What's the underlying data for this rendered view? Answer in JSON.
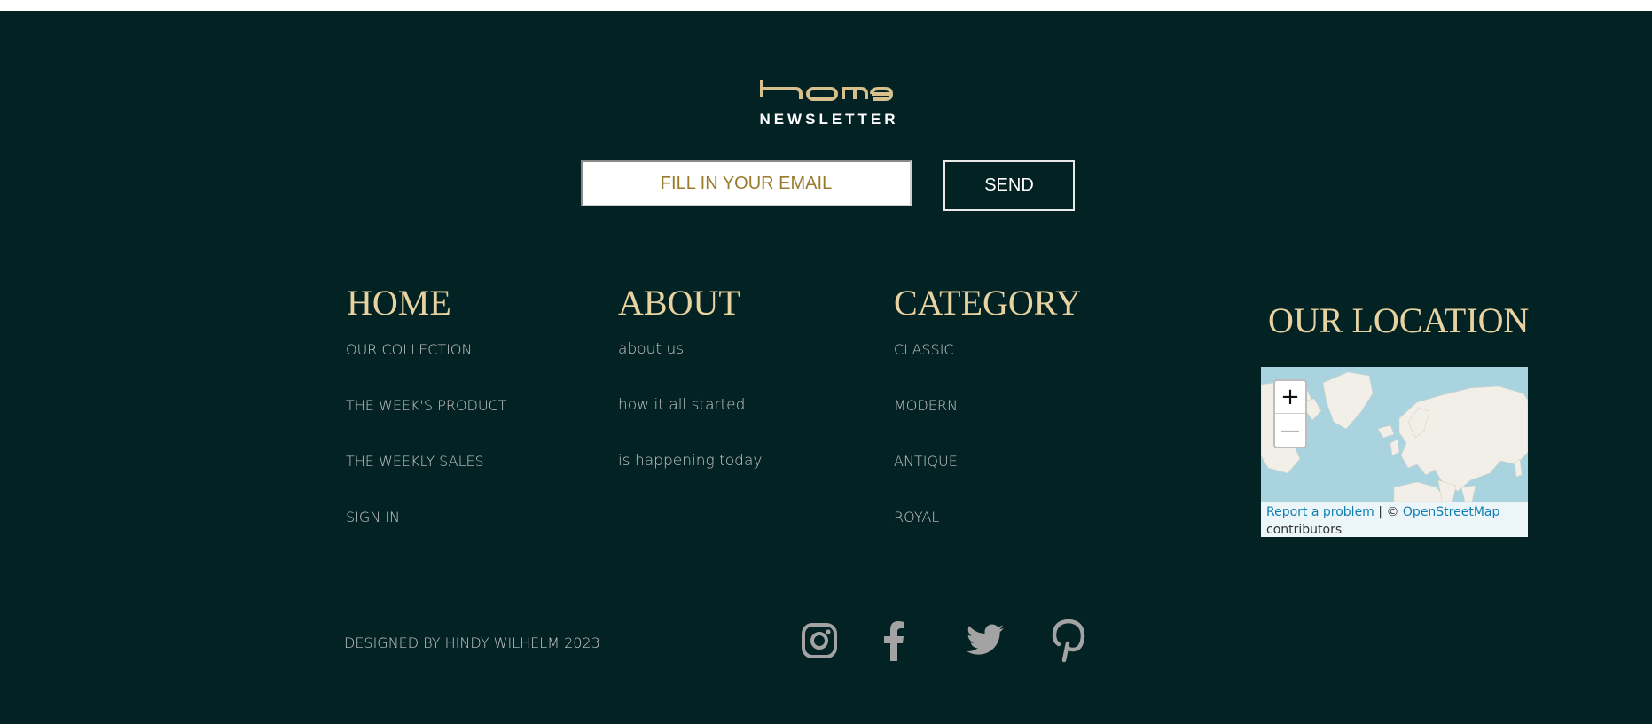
{
  "brand": {
    "logo_text": "home",
    "newsletter_title": "NEWSLETTER"
  },
  "newsletter": {
    "email_placeholder": "FILL IN YOUR EMAIL",
    "send_label": "SEND"
  },
  "columns": {
    "home": {
      "heading": "HOME",
      "links": [
        "OUR COLLECTION",
        "THE WEEK'S PRODUCT",
        "THE WEEKLY SALES",
        "SIGN IN"
      ]
    },
    "about": {
      "heading": "ABOUT",
      "links": [
        "about us",
        "how it all started",
        "is happening today"
      ]
    },
    "category": {
      "heading": "CATEGORY",
      "links": [
        "CLASSIC",
        "MODERN",
        "ANTIQUE",
        "ROYAL"
      ]
    }
  },
  "location": {
    "heading": "OUR LOCATION",
    "zoom_in": "+",
    "zoom_out": "—",
    "report_link": "Report a problem",
    "attrib_sep": " | © ",
    "osm_link": "OpenStreetMap",
    "attrib_tail": "contributors"
  },
  "credit": "DESIGNED BY HINDY WILHELM 2023",
  "social_icons": [
    "instagram-icon",
    "facebook-icon",
    "twitter-icon",
    "pinterest-icon"
  ],
  "colors": {
    "background": "#032224",
    "gold": "#e8d3a0",
    "link_gray": "#c7c7c7",
    "placeholder_gold": "#9a7b2c",
    "map_water": "#a9d3de",
    "map_land": "#f2efe9"
  }
}
